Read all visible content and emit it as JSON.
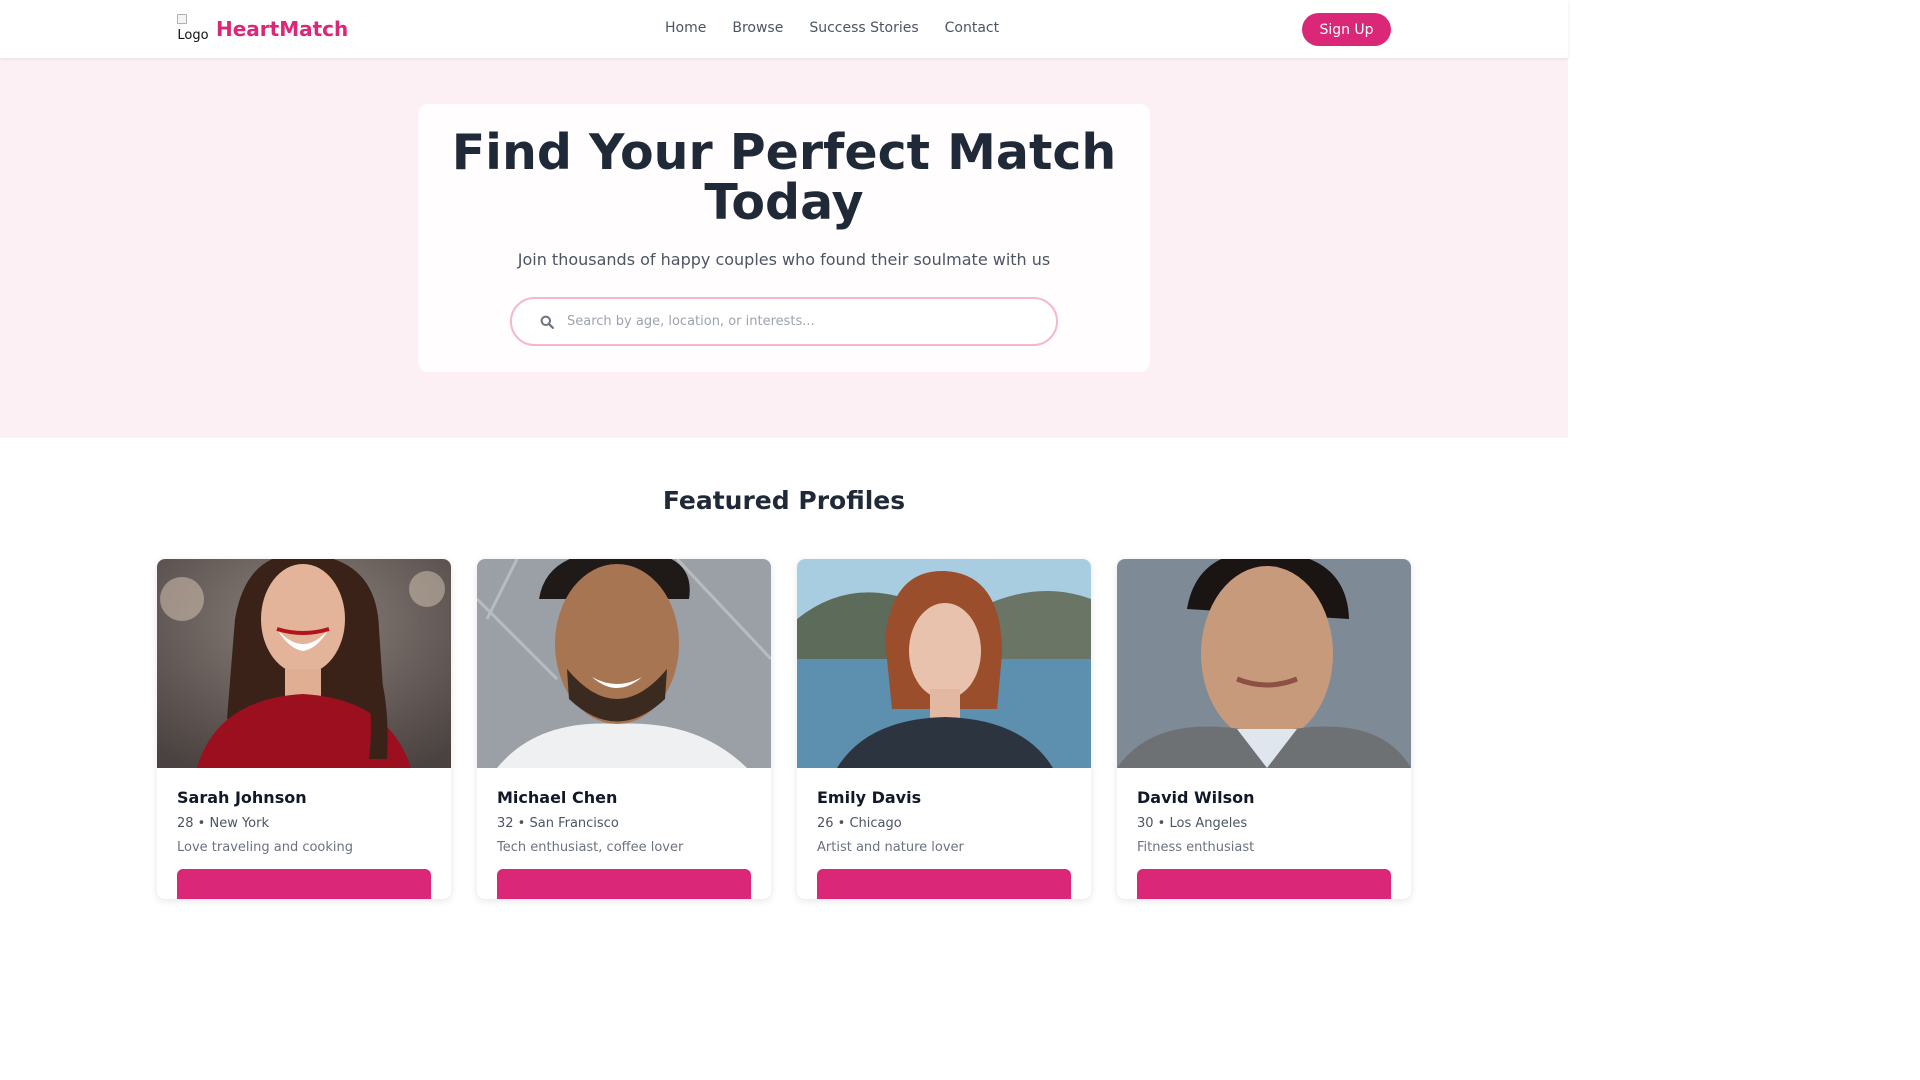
{
  "header": {
    "logo_alt": "Logo",
    "brand": "HeartMatch",
    "nav": [
      "Home",
      "Browse",
      "Success Stories",
      "Contact"
    ],
    "signup_label": "Sign Up"
  },
  "hero": {
    "title": "Find Your Perfect Match Today",
    "subtitle": "Join thousands of happy couples who found their soulmate with us",
    "search_placeholder": "Search by age, location, or interests..."
  },
  "featured": {
    "title": "Featured Profiles",
    "profiles": [
      {
        "name": "Sarah Johnson",
        "meta": "28 • New York",
        "bio": "Love traveling and cooking"
      },
      {
        "name": "Michael Chen",
        "meta": "32 • San Francisco",
        "bio": "Tech enthusiast, coffee lover"
      },
      {
        "name": "Emily Davis",
        "meta": "26 • Chicago",
        "bio": "Artist and nature lover"
      },
      {
        "name": "David Wilson",
        "meta": "30 • Los Angeles",
        "bio": "Fitness enthusiast"
      }
    ]
  },
  "colors": {
    "brand": "#db2777",
    "hero_bg": "#fdf0f5",
    "text_dark": "#1f2937"
  },
  "icons": [
    "search-icon",
    "logo-image"
  ]
}
